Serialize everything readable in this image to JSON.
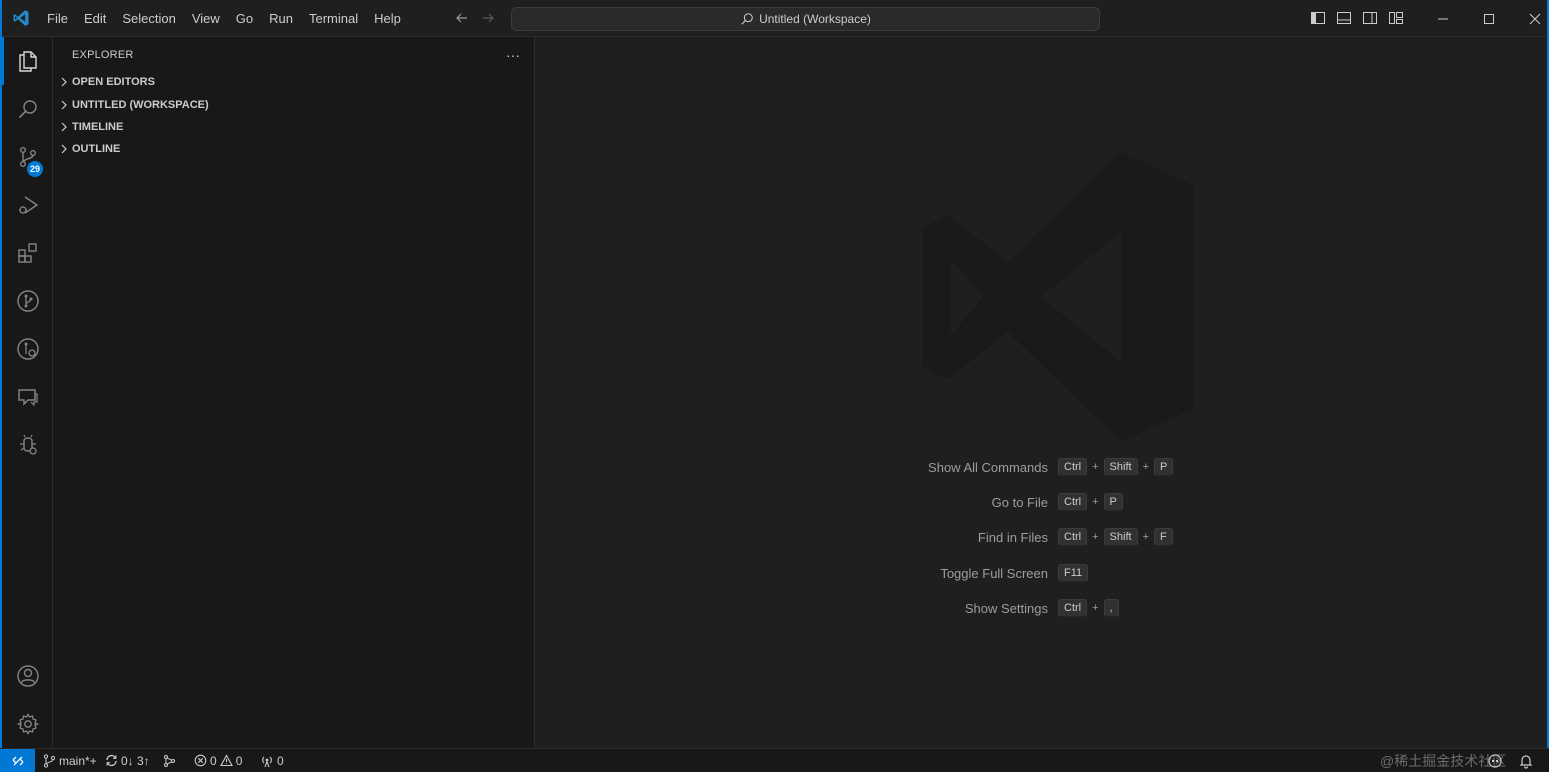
{
  "titlebar": {
    "menu": [
      "File",
      "Edit",
      "Selection",
      "View",
      "Go",
      "Run",
      "Terminal",
      "Help"
    ],
    "command_center": "Untitled (Workspace)"
  },
  "activitybar": {
    "items": [
      {
        "name": "explorer-icon"
      },
      {
        "name": "search-icon"
      },
      {
        "name": "source-control-icon",
        "badge": "29"
      },
      {
        "name": "run-debug-icon"
      },
      {
        "name": "extensions-icon"
      },
      {
        "name": "git-graph-icon"
      },
      {
        "name": "git-lens-icon"
      },
      {
        "name": "comments-icon"
      },
      {
        "name": "bug-search-icon"
      }
    ],
    "bottom": [
      {
        "name": "account-icon"
      },
      {
        "name": "settings-gear-icon"
      }
    ]
  },
  "sidebar": {
    "title": "EXPLORER",
    "more": "···",
    "sections": [
      "OPEN EDITORS",
      "UNTITLED (WORKSPACE)",
      "TIMELINE",
      "OUTLINE"
    ]
  },
  "editor": {
    "shortcuts": [
      {
        "label": "Show All Commands",
        "keys": [
          "Ctrl",
          "Shift",
          "P"
        ]
      },
      {
        "label": "Go to File",
        "keys": [
          "Ctrl",
          "P"
        ]
      },
      {
        "label": "Find in Files",
        "keys": [
          "Ctrl",
          "Shift",
          "F"
        ]
      },
      {
        "label": "Toggle Full Screen",
        "keys": [
          "F11"
        ]
      },
      {
        "label": "Show Settings",
        "keys": [
          "Ctrl",
          ","
        ]
      }
    ]
  },
  "statusbar": {
    "branch": "main*+",
    "sync": "0↓ 3↑",
    "errors": "0",
    "warnings": "0",
    "ports": "0",
    "watermark": "@稀土掘金技术社区"
  },
  "colors": {
    "accent": "#0078d4",
    "background": "#1f1f1f",
    "sidebar": "#181818"
  }
}
